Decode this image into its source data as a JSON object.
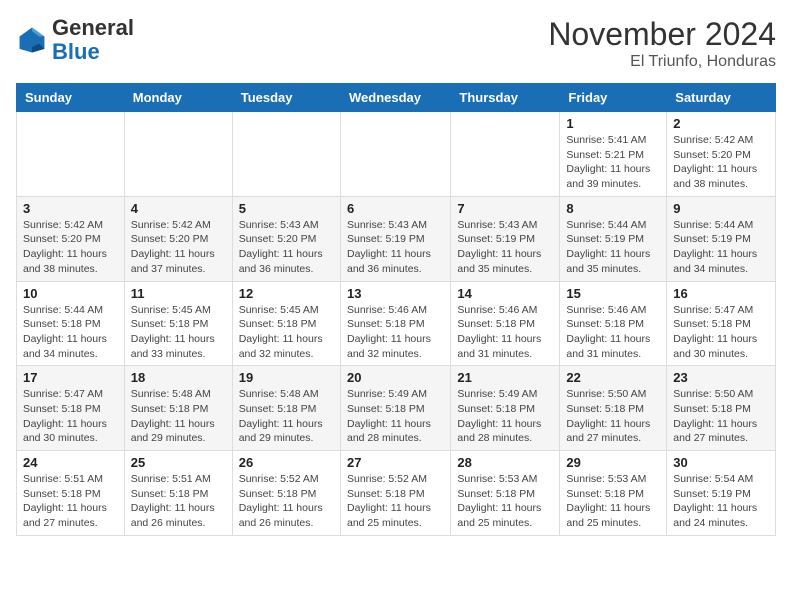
{
  "logo": {
    "general": "General",
    "blue": "Blue"
  },
  "title": "November 2024",
  "location": "El Triunfo, Honduras",
  "weekdays": [
    "Sunday",
    "Monday",
    "Tuesday",
    "Wednesday",
    "Thursday",
    "Friday",
    "Saturday"
  ],
  "weeks": [
    [
      {
        "day": "",
        "info": ""
      },
      {
        "day": "",
        "info": ""
      },
      {
        "day": "",
        "info": ""
      },
      {
        "day": "",
        "info": ""
      },
      {
        "day": "",
        "info": ""
      },
      {
        "day": "1",
        "info": "Sunrise: 5:41 AM\nSunset: 5:21 PM\nDaylight: 11 hours\nand 39 minutes."
      },
      {
        "day": "2",
        "info": "Sunrise: 5:42 AM\nSunset: 5:20 PM\nDaylight: 11 hours\nand 38 minutes."
      }
    ],
    [
      {
        "day": "3",
        "info": "Sunrise: 5:42 AM\nSunset: 5:20 PM\nDaylight: 11 hours\nand 38 minutes."
      },
      {
        "day": "4",
        "info": "Sunrise: 5:42 AM\nSunset: 5:20 PM\nDaylight: 11 hours\nand 37 minutes."
      },
      {
        "day": "5",
        "info": "Sunrise: 5:43 AM\nSunset: 5:20 PM\nDaylight: 11 hours\nand 36 minutes."
      },
      {
        "day": "6",
        "info": "Sunrise: 5:43 AM\nSunset: 5:19 PM\nDaylight: 11 hours\nand 36 minutes."
      },
      {
        "day": "7",
        "info": "Sunrise: 5:43 AM\nSunset: 5:19 PM\nDaylight: 11 hours\nand 35 minutes."
      },
      {
        "day": "8",
        "info": "Sunrise: 5:44 AM\nSunset: 5:19 PM\nDaylight: 11 hours\nand 35 minutes."
      },
      {
        "day": "9",
        "info": "Sunrise: 5:44 AM\nSunset: 5:19 PM\nDaylight: 11 hours\nand 34 minutes."
      }
    ],
    [
      {
        "day": "10",
        "info": "Sunrise: 5:44 AM\nSunset: 5:18 PM\nDaylight: 11 hours\nand 34 minutes."
      },
      {
        "day": "11",
        "info": "Sunrise: 5:45 AM\nSunset: 5:18 PM\nDaylight: 11 hours\nand 33 minutes."
      },
      {
        "day": "12",
        "info": "Sunrise: 5:45 AM\nSunset: 5:18 PM\nDaylight: 11 hours\nand 32 minutes."
      },
      {
        "day": "13",
        "info": "Sunrise: 5:46 AM\nSunset: 5:18 PM\nDaylight: 11 hours\nand 32 minutes."
      },
      {
        "day": "14",
        "info": "Sunrise: 5:46 AM\nSunset: 5:18 PM\nDaylight: 11 hours\nand 31 minutes."
      },
      {
        "day": "15",
        "info": "Sunrise: 5:46 AM\nSunset: 5:18 PM\nDaylight: 11 hours\nand 31 minutes."
      },
      {
        "day": "16",
        "info": "Sunrise: 5:47 AM\nSunset: 5:18 PM\nDaylight: 11 hours\nand 30 minutes."
      }
    ],
    [
      {
        "day": "17",
        "info": "Sunrise: 5:47 AM\nSunset: 5:18 PM\nDaylight: 11 hours\nand 30 minutes."
      },
      {
        "day": "18",
        "info": "Sunrise: 5:48 AM\nSunset: 5:18 PM\nDaylight: 11 hours\nand 29 minutes."
      },
      {
        "day": "19",
        "info": "Sunrise: 5:48 AM\nSunset: 5:18 PM\nDaylight: 11 hours\nand 29 minutes."
      },
      {
        "day": "20",
        "info": "Sunrise: 5:49 AM\nSunset: 5:18 PM\nDaylight: 11 hours\nand 28 minutes."
      },
      {
        "day": "21",
        "info": "Sunrise: 5:49 AM\nSunset: 5:18 PM\nDaylight: 11 hours\nand 28 minutes."
      },
      {
        "day": "22",
        "info": "Sunrise: 5:50 AM\nSunset: 5:18 PM\nDaylight: 11 hours\nand 27 minutes."
      },
      {
        "day": "23",
        "info": "Sunrise: 5:50 AM\nSunset: 5:18 PM\nDaylight: 11 hours\nand 27 minutes."
      }
    ],
    [
      {
        "day": "24",
        "info": "Sunrise: 5:51 AM\nSunset: 5:18 PM\nDaylight: 11 hours\nand 27 minutes."
      },
      {
        "day": "25",
        "info": "Sunrise: 5:51 AM\nSunset: 5:18 PM\nDaylight: 11 hours\nand 26 minutes."
      },
      {
        "day": "26",
        "info": "Sunrise: 5:52 AM\nSunset: 5:18 PM\nDaylight: 11 hours\nand 26 minutes."
      },
      {
        "day": "27",
        "info": "Sunrise: 5:52 AM\nSunset: 5:18 PM\nDaylight: 11 hours\nand 25 minutes."
      },
      {
        "day": "28",
        "info": "Sunrise: 5:53 AM\nSunset: 5:18 PM\nDaylight: 11 hours\nand 25 minutes."
      },
      {
        "day": "29",
        "info": "Sunrise: 5:53 AM\nSunset: 5:18 PM\nDaylight: 11 hours\nand 25 minutes."
      },
      {
        "day": "30",
        "info": "Sunrise: 5:54 AM\nSunset: 5:19 PM\nDaylight: 11 hours\nand 24 minutes."
      }
    ]
  ]
}
